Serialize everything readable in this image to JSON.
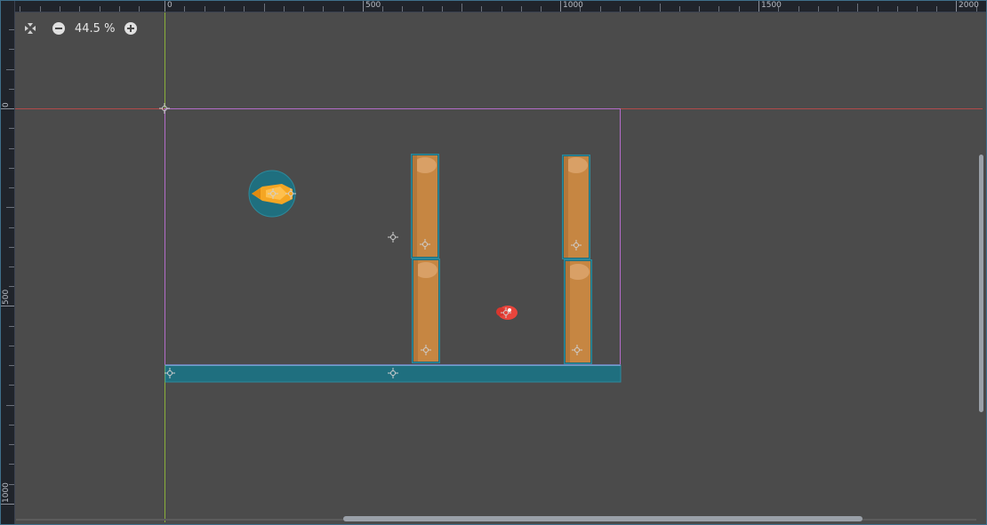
{
  "zoom": {
    "label": "44.5 %"
  },
  "ruler": {
    "top_labels": [
      "0",
      "500",
      "1000",
      "1500",
      "2000"
    ],
    "left_labels": [
      "0",
      "500",
      "1000"
    ]
  },
  "colors": {
    "background": "#4b4b4b",
    "ruler": "#20242b",
    "viewport_frame": "#b46cc9",
    "x_axis": "#b24a4a",
    "y_axis": "#8ab03a",
    "collision": "#1f6f7f",
    "pillar": "#c68642",
    "player": "#f5a623",
    "enemy": "#e8453c"
  },
  "icons": {
    "center_view": "center-view-icon",
    "zoom_out": "zoom-out-icon",
    "zoom_in": "zoom-in-icon",
    "pivot": "pivot-icon"
  }
}
